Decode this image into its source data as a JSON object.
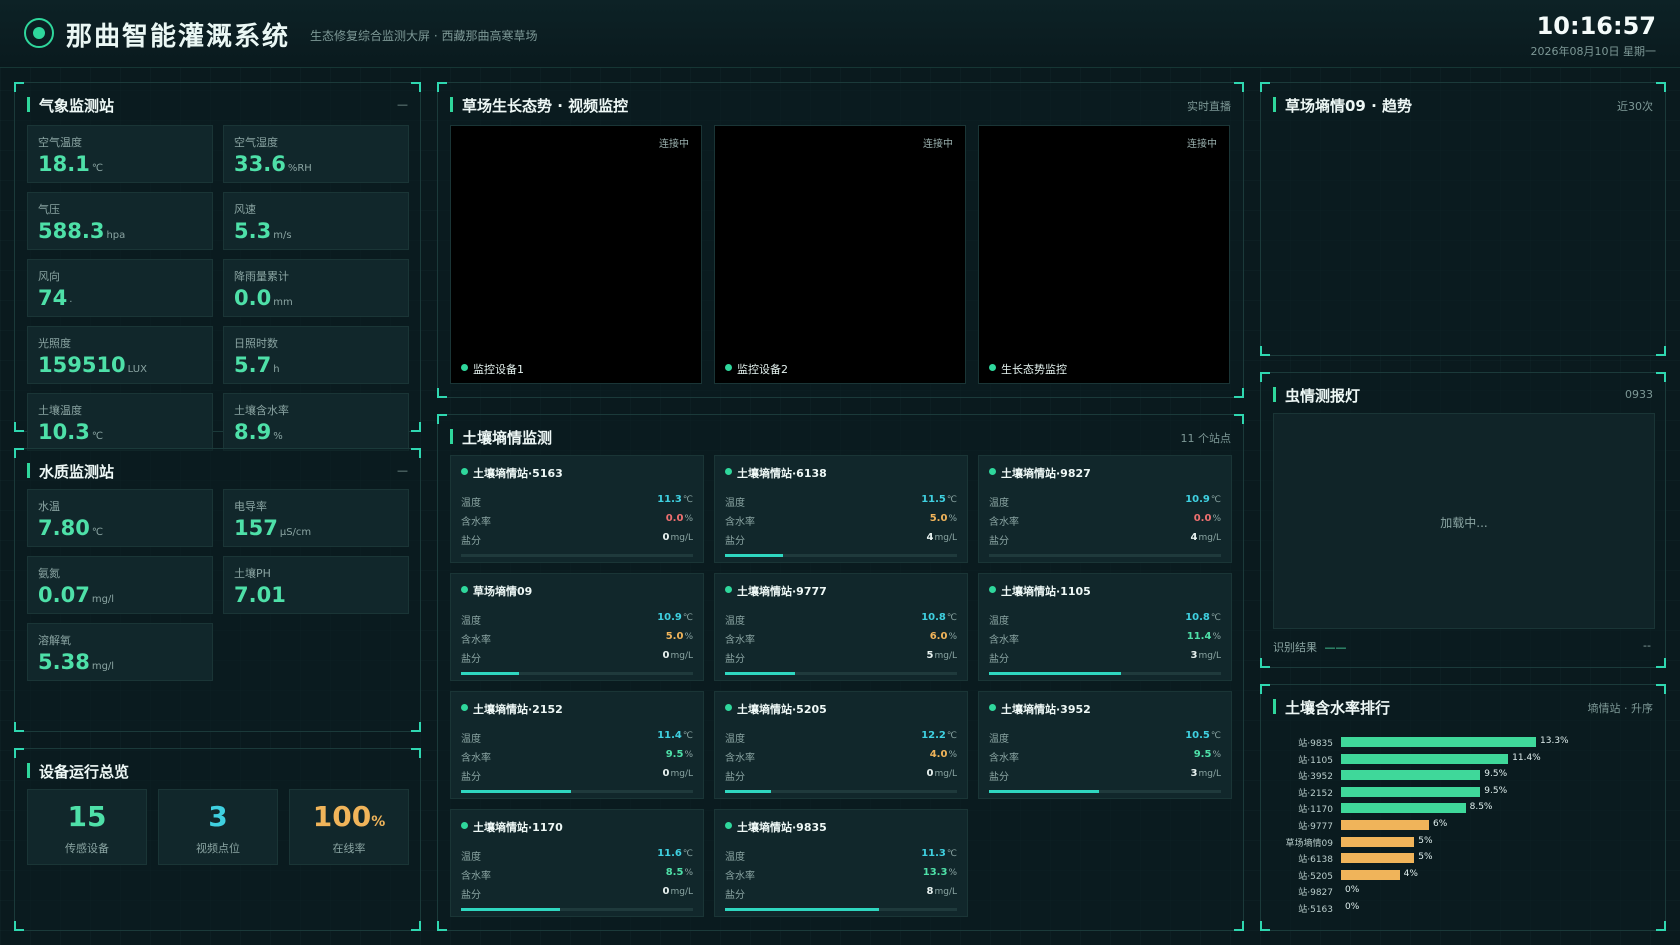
{
  "header": {
    "title": "那曲智能灌溉系统",
    "subtitle": "生态修复综合监测大屏 · 西藏那曲高寒草场",
    "time": "10:16:57",
    "date": "2026年08月10日 星期一"
  },
  "weather": {
    "title": "气象监测站",
    "extra": "—",
    "tiles": [
      {
        "label": "空气温度",
        "value": "18.1",
        "unit": "℃"
      },
      {
        "label": "空气湿度",
        "value": "33.6",
        "unit": "%RH"
      },
      {
        "label": "气压",
        "value": "588.3",
        "unit": "hpa"
      },
      {
        "label": "风速",
        "value": "5.3",
        "unit": "m/s"
      },
      {
        "label": "风向",
        "value": "74",
        "unit": "·"
      },
      {
        "label": "降雨量累计",
        "value": "0.0",
        "unit": "mm"
      },
      {
        "label": "光照度",
        "value": "159510",
        "unit": "LUX"
      },
      {
        "label": "日照时数",
        "value": "5.7",
        "unit": "h"
      },
      {
        "label": "土壤温度",
        "value": "10.3",
        "unit": "℃"
      },
      {
        "label": "土壤含水率",
        "value": "8.9",
        "unit": "%"
      }
    ]
  },
  "water": {
    "title": "水质监测站",
    "extra": "—",
    "tiles": [
      {
        "label": "水温",
        "value": "7.80",
        "unit": "℃"
      },
      {
        "label": "电导率",
        "value": "157",
        "unit": "μS/cm"
      },
      {
        "label": "氨氮",
        "value": "0.07",
        "unit": "mg/l"
      },
      {
        "label": "土壤PH",
        "value": "7.01",
        "unit": ""
      },
      {
        "label": "溶解氧",
        "value": "5.38",
        "unit": "mg/l"
      }
    ]
  },
  "devices": {
    "title": "设备运行总览",
    "stats": [
      {
        "value": "15",
        "suffix": "",
        "label": "传感设备",
        "color": "#4ee0a8"
      },
      {
        "value": "3",
        "suffix": "",
        "label": "视频点位",
        "color": "#3fd0e0"
      },
      {
        "value": "100",
        "suffix": "%",
        "label": "在线率",
        "color": "#f0b45a"
      }
    ]
  },
  "video": {
    "title": "草场生长态势 · 视频监控",
    "extra": "实时直播",
    "cams": [
      {
        "status": "连接中",
        "name": "监控设备1"
      },
      {
        "status": "连接中",
        "name": "监控设备2"
      },
      {
        "status": "连接中",
        "name": "生长态势监控"
      }
    ]
  },
  "soil": {
    "title": "土壤墒情监测",
    "extra": "11 个站点",
    "labels": {
      "temp": "温度",
      "moist": "含水率",
      "salt": "盐分"
    },
    "units": {
      "temp": "℃",
      "moist": "%",
      "salt": "mg/L"
    },
    "stations": [
      {
        "name": "土壤墒情站·5163",
        "temp": "11.3",
        "moist": "0.0",
        "salt": "0",
        "level": 0.0,
        "mc": "#f07070"
      },
      {
        "name": "土壤墒情站·6138",
        "temp": "11.5",
        "moist": "5.0",
        "salt": "4",
        "level": 0.25,
        "mc": "#f0b45a"
      },
      {
        "name": "土壤墒情站·9827",
        "temp": "10.9",
        "moist": "0.0",
        "salt": "4",
        "level": 0.0,
        "mc": "#f07070"
      },
      {
        "name": "草场墒情09",
        "temp": "10.9",
        "moist": "5.0",
        "salt": "0",
        "level": 0.25,
        "mc": "#f0b45a"
      },
      {
        "name": "土壤墒情站·9777",
        "temp": "10.8",
        "moist": "6.0",
        "salt": "5",
        "level": 0.3,
        "mc": "#f0b45a"
      },
      {
        "name": "土壤墒情站·1105",
        "temp": "10.8",
        "moist": "11.4",
        "salt": "3",
        "level": 0.57,
        "mc": "#4ee0a8"
      },
      {
        "name": "土壤墒情站·2152",
        "temp": "11.4",
        "moist": "9.5",
        "salt": "0",
        "level": 0.475,
        "mc": "#4ee0a8"
      },
      {
        "name": "土壤墒情站·5205",
        "temp": "12.2",
        "moist": "4.0",
        "salt": "0",
        "level": 0.2,
        "mc": "#f0b45a"
      },
      {
        "name": "土壤墒情站·3952",
        "temp": "10.5",
        "moist": "9.5",
        "salt": "3",
        "level": 0.475,
        "mc": "#4ee0a8"
      },
      {
        "name": "土壤墒情站·1170",
        "temp": "11.6",
        "moist": "8.5",
        "salt": "0",
        "level": 0.425,
        "mc": "#4ee0a8"
      },
      {
        "name": "土壤墒情站·9835",
        "temp": "11.3",
        "moist": "13.3",
        "salt": "8",
        "level": 0.665,
        "mc": "#4ee0a8"
      }
    ]
  },
  "trend": {
    "title": "草场墒情09 · 趋势",
    "extra": "近30次"
  },
  "pest": {
    "title": "虫情测报灯",
    "extra": "0933",
    "loading": "加载中...",
    "result_label": "识别结果",
    "result_value": "——",
    "result_extra": "--"
  },
  "ranking": {
    "title": "土壤含水率排行",
    "extra": "墒情站 · 升序",
    "chart_data": {
      "type": "bar",
      "orientation": "horizontal",
      "categories": [
        "站·9835",
        "站·1105",
        "站·3952",
        "站·2152",
        "站·1170",
        "站·9777",
        "草场墒情09",
        "站·6138",
        "站·5205",
        "站·9827",
        "站·5163"
      ],
      "values": [
        13.3,
        11.4,
        9.5,
        9.5,
        8.5,
        6,
        5,
        5,
        4,
        0,
        0
      ],
      "labels": [
        "13.3%",
        "11.4%",
        "9.5%",
        "9.5%",
        "8.5%",
        "6%",
        "5%",
        "5%",
        "4%",
        "0%",
        "0%"
      ],
      "colors": {
        "high": "#3fd89a",
        "low": "#f0b45a"
      }
    }
  }
}
